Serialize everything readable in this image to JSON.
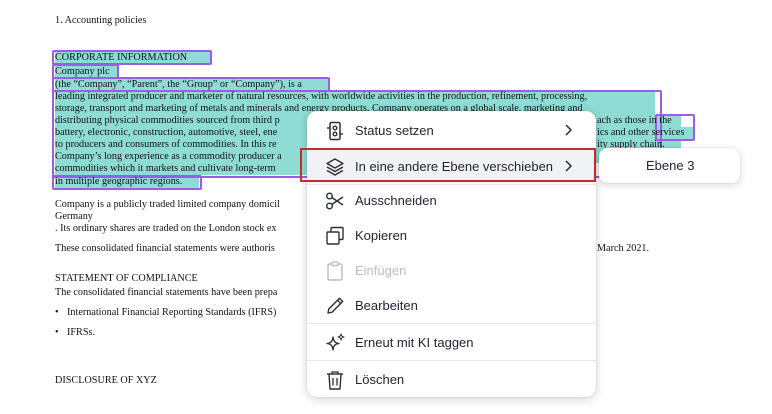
{
  "document": {
    "heading_policies": "1. Accounting policies",
    "corporate_info_title": "CORPORATE INFORMATION",
    "company_name": "Company plc",
    "paragraph_lines": [
      "(the “Company”, “Parent”, the “Group” or “Company”), is a",
      "leading integrated producer and marketer of natural resources, with worldwide activities in the production, refinement, processing,",
      "storage, transport and marketing of metals and minerals and energy products. Company operates on a global scale, marketing and",
      "distributing physical commodities sourced from third p",
      "battery, electronic, construction, automotive, steel, ene",
      "to producers and consumers of commodities. In this re",
      "Company’s long experience as a commodity producer a",
      "commodities which it markets and cultivate long-term",
      "in multiple geographic regions."
    ],
    "paragraph_right_fragments": [
      "ach as those in the",
      "ics and other services",
      "ity supply chain."
    ],
    "listing_lines": [
      "Company is a publicly traded limited company domicil",
      "Germany",
      ". Its ordinary shares are traded on the London stock ex"
    ],
    "authorised_line": "These consolidated financial statements were authoris",
    "authorised_right": "March 2021.",
    "compliance_title": "STATEMENT OF COMPLIANCE",
    "compliance_text": "The consolidated financial statements have been prepa",
    "bullets": [
      "International Financial Reporting Standards (IFRS)",
      "IFRSs."
    ],
    "disclosure_title": "DISCLOSURE OF XYZ"
  },
  "context_menu": {
    "items": [
      {
        "label": "Status setzen",
        "icon": "status-icon",
        "has_submenu": true,
        "disabled": false
      },
      {
        "label": "In eine andere Ebene verschieben",
        "icon": "layers-icon",
        "has_submenu": true,
        "disabled": false
      },
      {
        "label": "Ausschneiden",
        "icon": "scissors-icon",
        "has_submenu": false,
        "disabled": false
      },
      {
        "label": "Kopieren",
        "icon": "copy-icon",
        "has_submenu": false,
        "disabled": false
      },
      {
        "label": "Einfügen",
        "icon": "paste-icon",
        "has_submenu": false,
        "disabled": true
      },
      {
        "label": "Bearbeiten",
        "icon": "edit-icon",
        "has_submenu": false,
        "disabled": false
      },
      {
        "label": "Erneut mit KI taggen",
        "icon": "sparkle-icon",
        "has_submenu": false,
        "disabled": false
      },
      {
        "label": "Löschen",
        "icon": "trash-icon",
        "has_submenu": false,
        "disabled": false
      }
    ]
  },
  "submenu": {
    "items": [
      {
        "label": "Ebene 3"
      }
    ]
  },
  "colors": {
    "highlight": "#8fdcd4",
    "selection_border": "#9b5de5",
    "focus_border": "#c72b2b",
    "menu_hover": "#f1f2f5"
  }
}
